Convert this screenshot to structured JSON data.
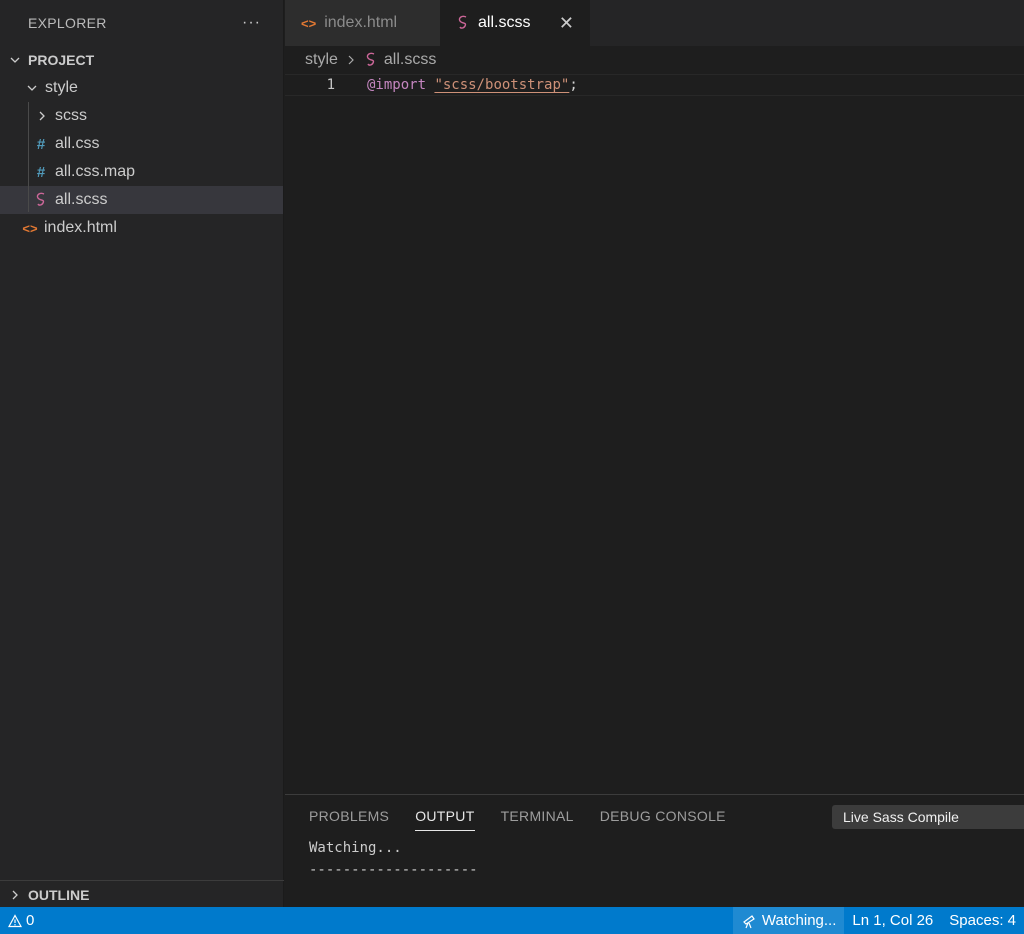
{
  "explorer": {
    "title": "EXPLORER",
    "more": "···",
    "project_label": "PROJECT",
    "tree": {
      "style": "style",
      "scss": "scss",
      "all_css": "all.css",
      "all_css_map": "all.css.map",
      "all_scss": "all.scss",
      "index_html": "index.html"
    },
    "outline_label": "OUTLINE"
  },
  "tabs": [
    {
      "label": "index.html",
      "icon": "html-file-icon",
      "active": false
    },
    {
      "label": "all.scss",
      "icon": "sass-file-icon",
      "active": true,
      "close": "✕"
    }
  ],
  "breadcrumb": {
    "folder": "style",
    "file": "all.scss"
  },
  "editor": {
    "line_number": "1",
    "keyword": "@import",
    "space": " ",
    "string": "\"scss/bootstrap\"",
    "semicolon": ";"
  },
  "panel": {
    "tabs": [
      "PROBLEMS",
      "OUTPUT",
      "TERMINAL",
      "DEBUG CONSOLE"
    ],
    "active_tab": "OUTPUT",
    "channel": "Live Sass Compile",
    "output_lines": [
      "Watching...",
      "--------------------"
    ]
  },
  "statusbar": {
    "problems_count": "0",
    "watching": "Watching...",
    "cursor": "Ln 1, Col 26",
    "spaces": "Spaces: 4"
  },
  "colors": {
    "accent": "#007acc",
    "sidebar_bg": "#252526",
    "editor_bg": "#1e1e1e",
    "sass_pink": "#cd6799",
    "html_orange": "#e37933",
    "css_blue": "#519aba"
  }
}
